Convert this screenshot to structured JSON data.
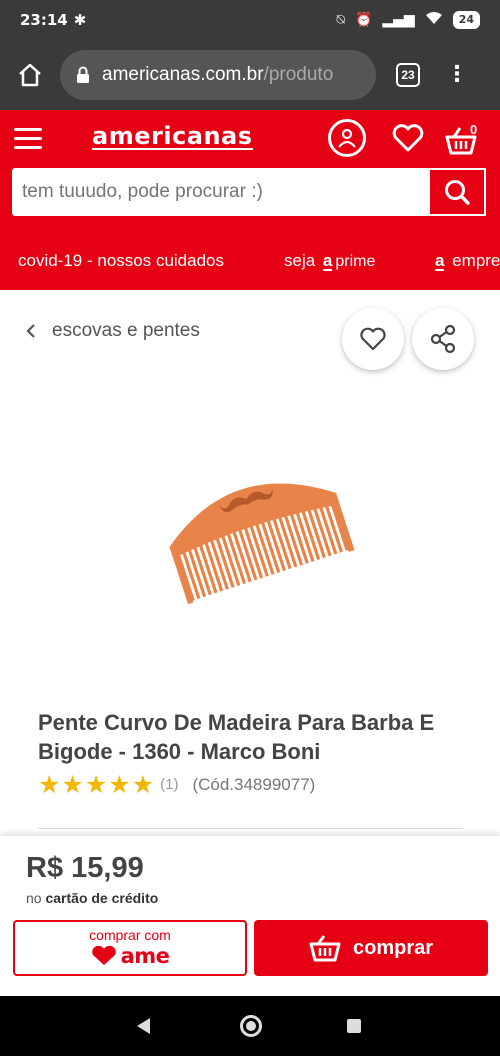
{
  "status_bar": {
    "time": "23:14",
    "battery": "24"
  },
  "browser": {
    "url_domain": "americanas.com.br",
    "url_path": "/produto",
    "tab_count": "23"
  },
  "header": {
    "logo": "americanas",
    "cart_count": "0",
    "search_placeholder": "tem tuuudo, pode procurar :)",
    "promo": {
      "covid": "covid-19 - nossos cuidados",
      "seja": "seja",
      "a_mark": "a",
      "prime": "prime",
      "a_mark_2": "a",
      "empresa": "empre"
    }
  },
  "breadcrumb": {
    "label": "escovas e pentes"
  },
  "product": {
    "title": "Pente Curvo De Madeira Para Barba E Bigode - 1360 - Marco Boni",
    "rating_stars": 5,
    "rating_count": "(1)",
    "code": "(Cód.34899077)"
  },
  "buy": {
    "price": "R$ 15,99",
    "price_note_prefix": "no",
    "price_note_bold": "cartão de crédito",
    "ame_label": "comprar com",
    "ame_brand": "ame",
    "buy_label": "comprar"
  },
  "colors": {
    "brand_red": "#e60014",
    "star_yellow": "#f2b705",
    "comb_wood": "#e8844a"
  }
}
